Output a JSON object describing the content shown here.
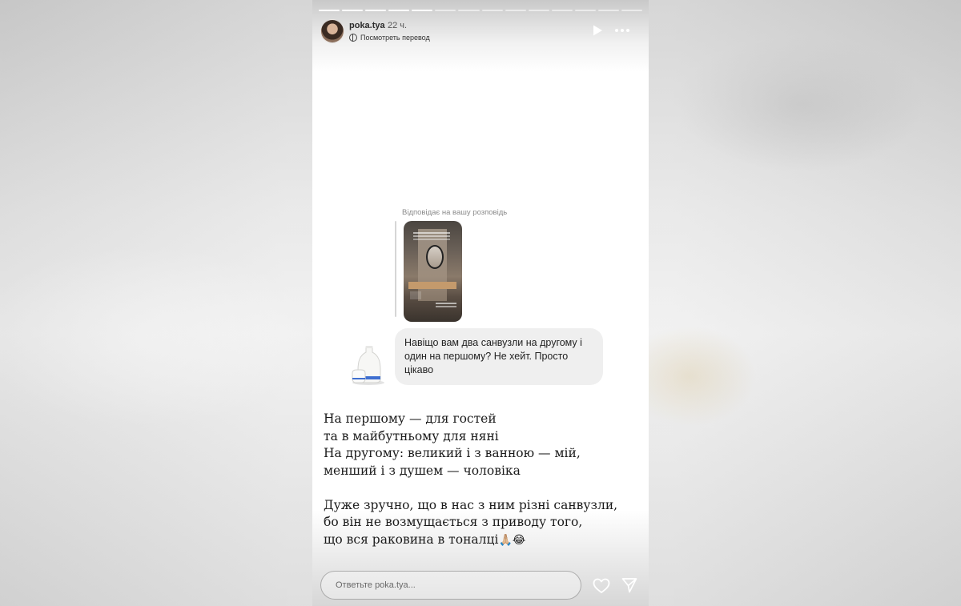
{
  "story": {
    "progress_segments": 14,
    "progress_completed": 5,
    "header": {
      "username": "poka.tya",
      "time": "22 ч.",
      "translate_label": "Посмотреть перевод"
    },
    "reply_context": {
      "label": "Відповідає на вашу розповідь"
    },
    "message": {
      "text": "Навіщо вам два санвузли на другому і один на першому? Не хейт. Просто цікаво"
    },
    "answer": {
      "text": "На першому — для гостей\nта в майбутньому для няні\nНа другому: великий і з ванною — мій,\nменший і з душем — чоловіка\n\nДуже зручно, що в нас з ним різні санвузли,\nбо він не возмущається з приводу того,\nщо вся раковина в тоналці",
      "emoji": "🙏🏼😂"
    },
    "footer": {
      "reply_placeholder": "Ответьте poka.tya..."
    },
    "colors": {
      "bubble": "#efefef",
      "text": "#1b1b1b",
      "muted": "#8a8a8a"
    },
    "icons": [
      "play-icon",
      "more-icon",
      "translate-icon",
      "heart-icon",
      "send-icon"
    ]
  }
}
